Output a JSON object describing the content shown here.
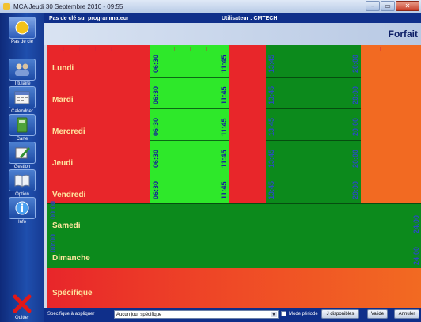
{
  "window": {
    "title": "MCA   Jeudi 30 Septembre 2010 - 09:55",
    "controls": [
      "–",
      "▭",
      "✕"
    ]
  },
  "sidebar": {
    "items": [
      {
        "label": "Pas de clé",
        "icon": "key-icon"
      },
      {
        "label": "Titulaire",
        "icon": "people-icon"
      },
      {
        "label": "Calendrier",
        "icon": "calendar-icon"
      },
      {
        "label": "Carte",
        "icon": "card-icon"
      },
      {
        "label": "Gestion",
        "icon": "pen-icon"
      },
      {
        "label": "Option",
        "icon": "book-icon"
      },
      {
        "label": "Info",
        "icon": "info-icon"
      },
      {
        "label": "Quitter",
        "icon": "close-icon"
      }
    ]
  },
  "header": {
    "left": "Pas de clé sur programmateur",
    "right": "Utilisateur : CMTECH"
  },
  "subheader": {
    "title": "Forfait"
  },
  "schedule": {
    "days": [
      {
        "name": "Lundi",
        "slots": [
          "06:30",
          "11:45",
          "13:45",
          "20:00"
        ]
      },
      {
        "name": "Mardi",
        "slots": [
          "06:30",
          "11:45",
          "13:45",
          "20:00"
        ]
      },
      {
        "name": "Mercredi",
        "slots": [
          "06:30",
          "11:45",
          "13:45",
          "20:00"
        ]
      },
      {
        "name": "Jeudi",
        "slots": [
          "06:30",
          "11:45",
          "13:45",
          "20:00"
        ]
      },
      {
        "name": "Vendredi",
        "slots": [
          "06:30",
          "11:45",
          "13:45",
          "20:00"
        ]
      },
      {
        "name": "Samedi",
        "slots": [
          "00:00",
          "24:00"
        ]
      },
      {
        "name": "Dimanche",
        "slots": [
          "00:00",
          "24:00"
        ]
      },
      {
        "name": "Spécifique",
        "slots": []
      }
    ],
    "colors": {
      "red": "#e8262a",
      "light_green": "#2ee82a",
      "dark_green": "#0c8a1c",
      "orange": "#f26a22"
    }
  },
  "bottombar": {
    "label": "Spécifique à appliquer",
    "select_value": "Aucun jour spécifique",
    "checkbox_label": "Mode période",
    "btn_dispo": "J disponibles",
    "btn_valider": "Valide",
    "btn_annuler": "Annuler"
  }
}
